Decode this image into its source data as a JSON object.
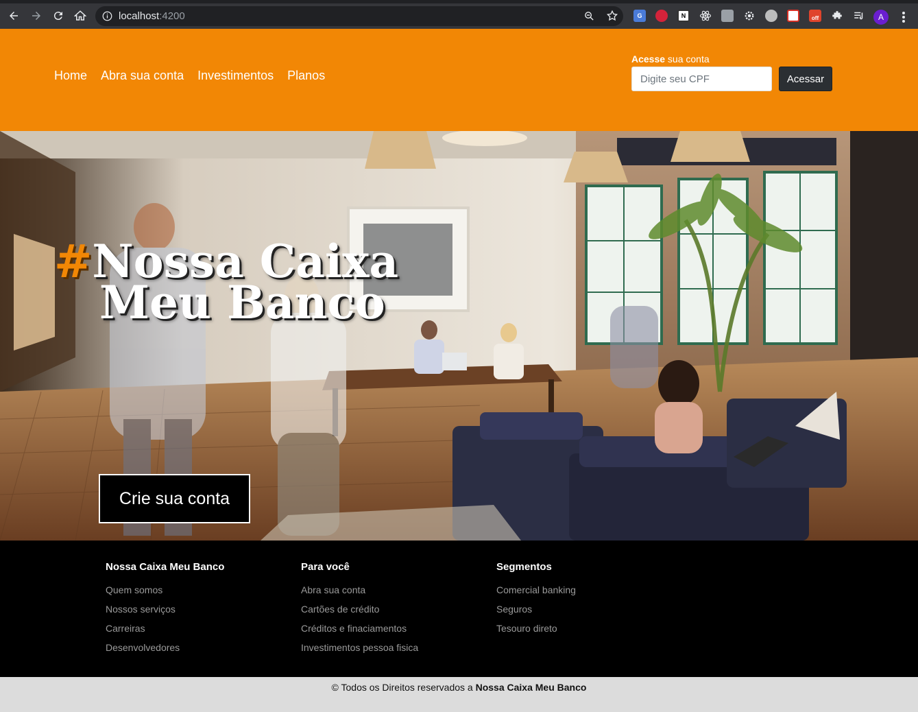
{
  "browser": {
    "url_host": "localhost",
    "url_port": ":4200",
    "avatar_letter": "A",
    "ext_badge": "off"
  },
  "header": {
    "nav": [
      "Home",
      "Abra sua conta",
      "Investimentos",
      "Planos"
    ],
    "login_label_bold": "Acesse",
    "login_label_rest": " sua conta",
    "cpf_placeholder": "Digite seu CPF",
    "login_button": "Acessar"
  },
  "hero": {
    "hash": "#",
    "title_line1": "Nossa Caixa",
    "title_line2": "Meu Banco",
    "cta": "Crie sua conta"
  },
  "footer": {
    "columns": [
      {
        "title": "Nossa Caixa Meu Banco",
        "links": [
          "Quem somos",
          "Nossos serviços",
          "Carreiras",
          "Desenvolvedores"
        ]
      },
      {
        "title": "Para você",
        "links": [
          "Abra sua conta",
          "Cartões de crédito",
          "Créditos e finaciamentos",
          "Investimentos pessoa fisica"
        ]
      },
      {
        "title": "Segmentos",
        "links": [
          "Comercial banking",
          "Seguros",
          "Tesouro direto"
        ]
      }
    ],
    "copyright_text": "© Todos os Direitos reservados a ",
    "copyright_brand": "Nossa Caixa Meu Banco"
  },
  "colors": {
    "brand_orange": "#f28705",
    "footer_bg": "#000000",
    "copyright_bg": "#dcdcdc"
  }
}
